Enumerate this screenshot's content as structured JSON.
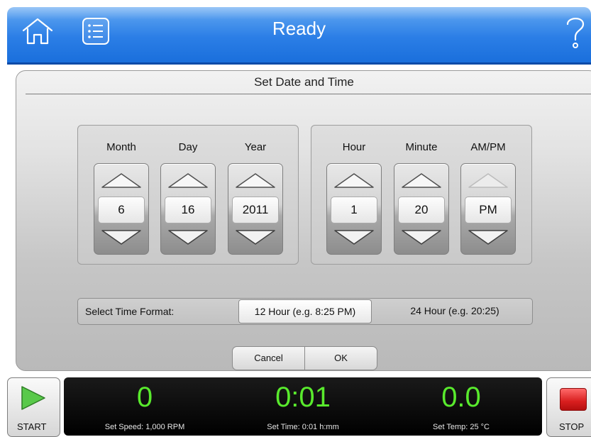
{
  "header": {
    "title": "Ready",
    "icons": {
      "home": "home-icon",
      "menu": "menu-list-icon",
      "help": "help-icon"
    },
    "colors": {
      "bar": "#2b7ee6",
      "bar_light": "#63a8f2"
    }
  },
  "dialog": {
    "title": "Set Date and Time",
    "date": {
      "month": {
        "label": "Month",
        "value": "6"
      },
      "day": {
        "label": "Day",
        "value": "16"
      },
      "year": {
        "label": "Year",
        "value": "2011"
      }
    },
    "time": {
      "hour": {
        "label": "Hour",
        "value": "1"
      },
      "minute": {
        "label": "Minute",
        "value": "20"
      },
      "ampm": {
        "label": "AM/PM",
        "value": "PM"
      }
    },
    "time_format": {
      "label": "Select Time Format:",
      "option_12": "12 Hour (e.g. 8:25 PM)",
      "option_24": "24 Hour (e.g. 20:25)",
      "selected": "12 Hour (e.g. 8:25 PM)"
    },
    "buttons": {
      "cancel": "Cancel",
      "ok": "OK"
    }
  },
  "status_bar": {
    "start_label": "START",
    "stop_label": "STOP",
    "speed": {
      "value": "0",
      "setpoint": "Set Speed: 1,000 RPM"
    },
    "time": {
      "value": "0:01",
      "setpoint": "Set Time: 0:01 h:mm"
    },
    "temp": {
      "value": "0.0",
      "setpoint": "Set Temp: 25 °C"
    },
    "colors": {
      "readout": "#59ea2d",
      "start": "#3fb53f",
      "stop": "#d81e1e"
    }
  }
}
